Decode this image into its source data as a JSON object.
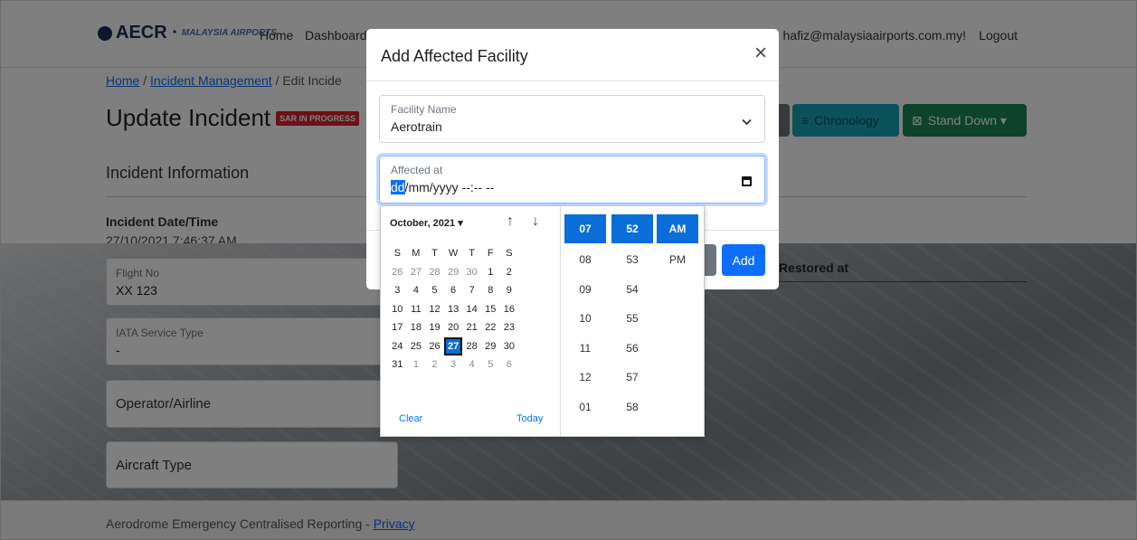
{
  "navbar": {
    "logo_text": "AECR ·",
    "logo_sub": "MALAYSIA AIRPORTS",
    "links": [
      "Home",
      "Dashboard"
    ],
    "user_email": "hafiz@malaysiaairports.com.my!",
    "logout_label": "Logout"
  },
  "breadcrumb": {
    "home": "Home",
    "sep1": "/",
    "incident_mgmt": "Incident Management",
    "sep2": "/",
    "current": "Edit Incide"
  },
  "page": {
    "title": "Update Incident",
    "status_badge": "SAR IN PROGRESS",
    "chronology_label": "Chronology",
    "stand_down_label": "Stand Down ▾",
    "section_title": "Incident Information",
    "incident_datetime_label": "Incident Date/Time",
    "incident_datetime_value": "27/10/2021 7:46:37 AM",
    "restored_at_header": "Restored at"
  },
  "form": {
    "flight_no": {
      "label": "Flight No",
      "value": "XX 123"
    },
    "iata_service_type": {
      "label": "IATA Service Type",
      "value": "-"
    },
    "operator_airline": {
      "label": "Operator/Airline"
    },
    "aircraft_type": {
      "label": "Aircraft Type"
    }
  },
  "footer": {
    "text": "Aerodrome Emergency Centralised Reporting - ",
    "privacy_link": "Privacy"
  },
  "modal": {
    "title": "Add Affected Facility",
    "close_symbol": "×",
    "facility_name": {
      "label": "Facility Name",
      "value": "Aerotrain"
    },
    "affected_at": {
      "label": "Affected at",
      "value_highlight": "dd",
      "value_rest": "/mm/yyyy --:-- --"
    },
    "add_label": "Add"
  },
  "datepicker": {
    "month_year": "October, 2021 ▾",
    "weekday_headers": [
      "S",
      "M",
      "T",
      "W",
      "T",
      "F",
      "S"
    ],
    "weeks": [
      [
        "26",
        "27",
        "28",
        "29",
        "30",
        "1",
        "2"
      ],
      [
        "3",
        "4",
        "5",
        "6",
        "7",
        "8",
        "9"
      ],
      [
        "10",
        "11",
        "12",
        "13",
        "14",
        "15",
        "16"
      ],
      [
        "17",
        "18",
        "19",
        "20",
        "21",
        "22",
        "23"
      ],
      [
        "24",
        "25",
        "26",
        "27",
        "28",
        "29",
        "30"
      ],
      [
        "31",
        "1",
        "2",
        "3",
        "4",
        "5",
        "6"
      ]
    ],
    "selected_day": "27",
    "clear_label": "Clear",
    "today_label": "Today",
    "hours": [
      "07",
      "08",
      "09",
      "10",
      "11",
      "12",
      "01"
    ],
    "minutes": [
      "52",
      "53",
      "54",
      "55",
      "56",
      "57",
      "58"
    ],
    "ampm": [
      "AM",
      "PM"
    ],
    "selected_hour": "07",
    "selected_minute": "52",
    "selected_ampm": "AM"
  },
  "colors": {
    "primary": "#0d6efd",
    "success": "#198754",
    "info": "#17a2b8",
    "danger": "#d9232e",
    "selected": "#0a6dd9"
  }
}
